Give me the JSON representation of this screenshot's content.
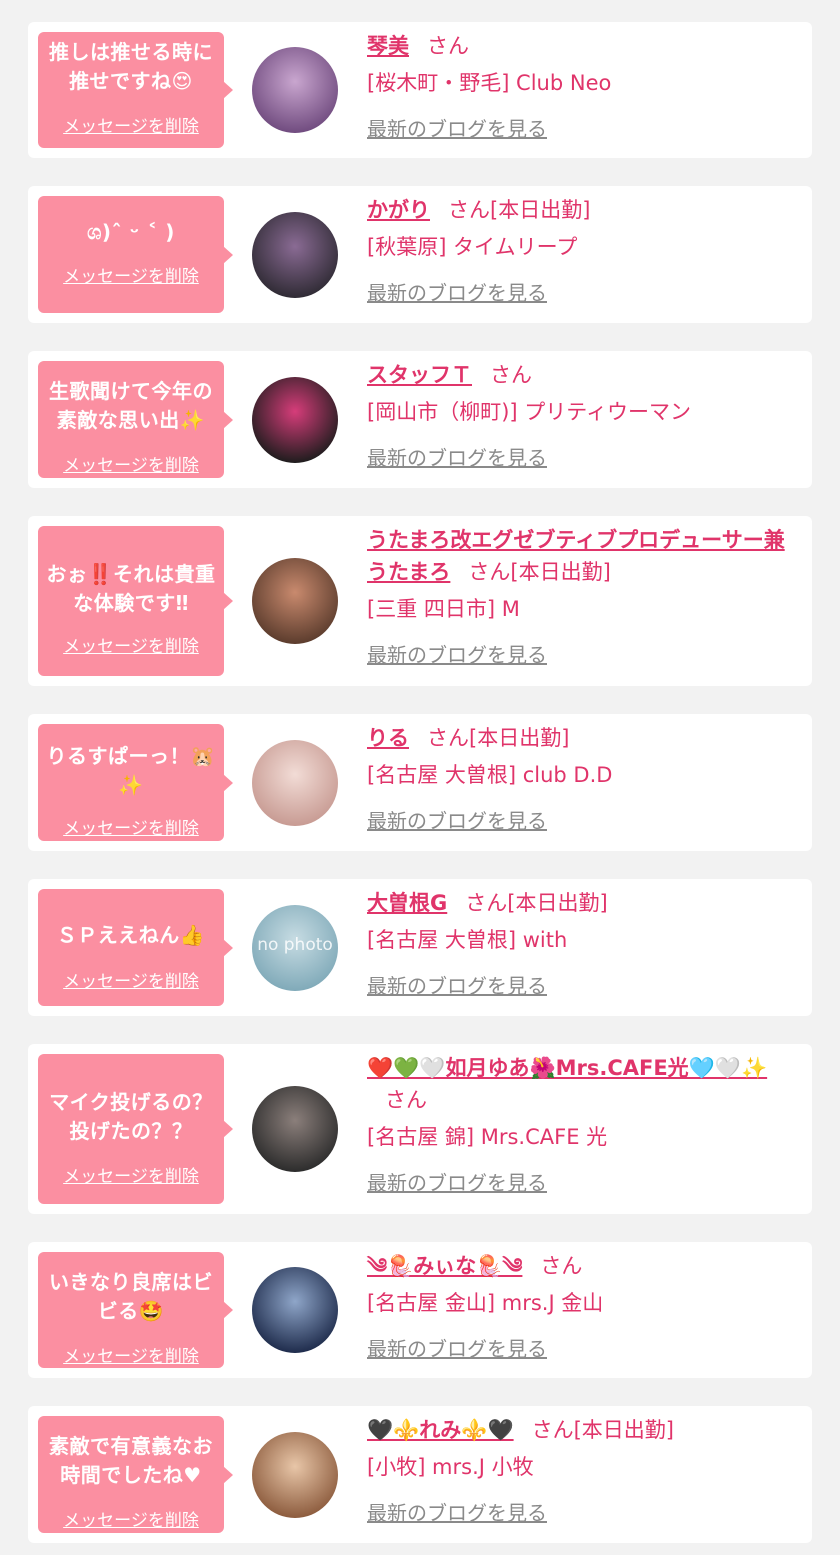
{
  "items": [
    {
      "message": "推しは推せる時に\n推せですね😍",
      "delete_label": "メッセージを削除",
      "name": "琴美",
      "san": "さん",
      "shop": "[桜木町・野毛] Club Neo",
      "blog_label": "最新のブログを見る",
      "avatar_colors": [
        "#6f4a7e",
        "#c9a6cf"
      ]
    },
    {
      "message": "ශ)ˆ ᵕ ˂ )",
      "delete_label": "メッセージを削除",
      "name": "かがり",
      "san": "さん[本日出勤]",
      "shop": "[秋葉原] タイムリープ",
      "blog_label": "最新のブログを見る",
      "avatar_colors": [
        "#2e2a33",
        "#8a6b94"
      ]
    },
    {
      "message": "生歌聞けて今年の\n素敵な思い出✨",
      "delete_label": "メッセージを削除",
      "name": "スタッフＴ",
      "san": "さん",
      "shop": "[岡山市（柳町)] プリティウーマン",
      "blog_label": "最新のブログを見る",
      "avatar_colors": [
        "#1c1c1c",
        "#d63d7a"
      ]
    },
    {
      "message": "おぉ‼️それは貴重\nな体験です‼",
      "delete_label": "メッセージを削除",
      "name": "うたまろ改エグゼブティブプロデューサー兼うたまろ",
      "san": "さん[本日出勤]",
      "shop": "[三重 四日市] M",
      "blog_label": "最新のブログを見る",
      "avatar_colors": [
        "#5a3b2c",
        "#c98a6e"
      ]
    },
    {
      "message": "りるすぱーっ！🐹\n✨",
      "delete_label": "メッセージを削除",
      "name": "りる",
      "san": "さん[本日出勤]",
      "shop": "[名古屋 大曽根] club D.D",
      "blog_label": "最新のブログを見る",
      "avatar_colors": [
        "#c79a92",
        "#f2dcd6"
      ]
    },
    {
      "message": "ＳＰええねん👍",
      "delete_label": "メッセージを削除",
      "name": "大曽根G",
      "san": "さん[本日出勤]",
      "shop": "[名古屋 大曽根] with",
      "blog_label": "最新のブログを見る",
      "avatar_colors": [
        "#7fa9b8",
        "#c7dce3"
      ],
      "avatar_text": "no photo"
    },
    {
      "message": "マイク投げるの？\n投げたの？？",
      "delete_label": "メッセージを削除",
      "name": "❤️💚🤍如月ゆあ🌺Mrs.CAFE光🩵🤍✨",
      "san": "さん",
      "shop": "[名古屋 錦] Mrs.CAFE 光",
      "blog_label": "最新のブログを見る",
      "avatar_colors": [
        "#2b2b2b",
        "#8b7f7b"
      ]
    },
    {
      "message": "いきなり良席はビ\nビる🤩",
      "delete_label": "メッセージを削除",
      "name": "༄🪼みぃな🪼༄",
      "san": "さん",
      "shop": "[名古屋 金山] mrs.J 金山",
      "blog_label": "最新のブログを見る",
      "avatar_colors": [
        "#1d2a4a",
        "#8fa6c9"
      ]
    },
    {
      "message": "素敵で有意義なお\n時間でしたね♥",
      "delete_label": "メッセージを削除",
      "name": "🖤⚜️れみ⚜️🖤",
      "san": "さん[本日出勤]",
      "shop": "[小牧] mrs.J 小牧",
      "blog_label": "最新のブログを見る",
      "avatar_colors": [
        "#8b5a3c",
        "#e8c6a8"
      ]
    }
  ]
}
